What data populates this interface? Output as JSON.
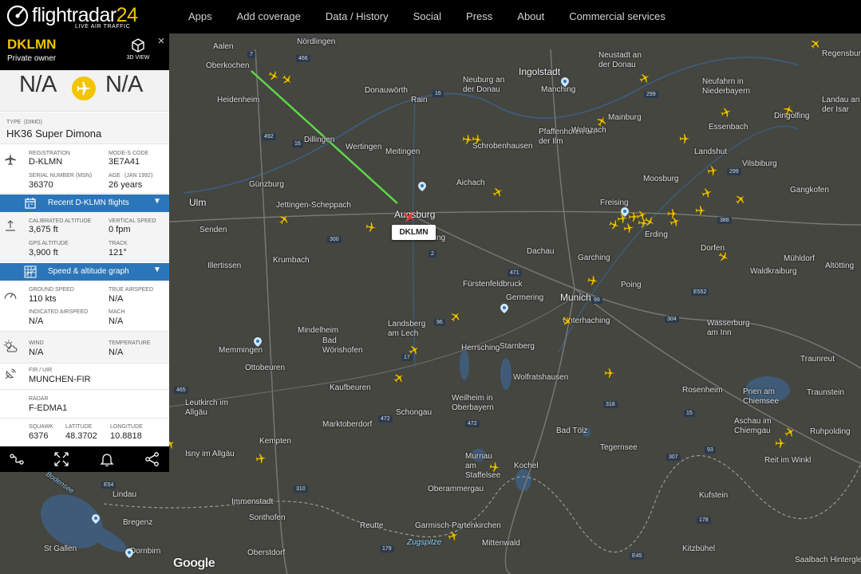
{
  "brand": {
    "name": "flightradar",
    "number": "24",
    "tagline": "LIVE AIR TRAFFIC"
  },
  "nav": [
    "Apps",
    "Add coverage",
    "Data / History",
    "Social",
    "Press",
    "About",
    "Commercial services"
  ],
  "panel": {
    "callsign": "DKLMN",
    "owner": "Private owner",
    "view3d": "3D VIEW",
    "close": "×",
    "origin": "N/A",
    "destination": "N/A",
    "type_label": "TYPE",
    "type_code": "(DIMO)",
    "type_name": "HK36 Super Dimona",
    "registration_label": "REGISTRATION",
    "registration": "D-KLMN",
    "modes_label": "MODE-S CODE",
    "modes": "3E7A41",
    "serial_label": "SERIAL NUMBER (MSN)",
    "serial": "36370",
    "age_label": "AGE",
    "age_date": "(JAN 1992)",
    "age": "26 years",
    "recent_flights": "Recent D-KLMN flights",
    "cal_alt_label": "CALIBRATED ALTITUDE",
    "cal_alt": "3,675 ft",
    "vspeed_label": "VERTICAL SPEED",
    "vspeed": "0 fpm",
    "gps_alt_label": "GPS ALTITUDE",
    "gps_alt": "3,900 ft",
    "track_label": "TRACK",
    "track": "121°",
    "speed_graph": "Speed & altitude graph",
    "gspeed_label": "GROUND SPEED",
    "gspeed": "110 kts",
    "tas_label": "TRUE AIRSPEED",
    "tas": "N/A",
    "ias_label": "INDICATED AIRSPEED",
    "ias": "N/A",
    "mach_label": "MACH",
    "mach": "N/A",
    "wind_label": "WIND",
    "wind": "N/A",
    "temp_label": "TEMPERATURE",
    "temp": "N/A",
    "fir_label": "FIR / UIR",
    "fir": "MUNCHEN-FIR",
    "radar_label": "RADAR",
    "radar": "F-EDMA1",
    "squawk_label": "SQUAWK",
    "squawk": "6376",
    "lat_label": "LATITUDE",
    "lat": "48.3702",
    "lon_label": "LONGITUDE",
    "lon": "10.8818"
  },
  "map": {
    "flight_tag": "DKLMN",
    "attribution": "Google",
    "towns": [
      "Aalen",
      "Nördlingen",
      "Oberkochen",
      "Heidenheim",
      "Donauwörth",
      "Rain",
      "Neuburg an der Donau",
      "Ingolstadt",
      "Manching",
      "Neustadt an der Donau",
      "Regensburg",
      "Neufahrn in Niederbayern",
      "Landau an der Isar",
      "Dillingen",
      "Wertingen",
      "Meitingen",
      "Schrobenhausen",
      "Pfaffenhofen an der Ilm",
      "Wolnzach",
      "Mainburg",
      "Essenbach",
      "Dingolfing",
      "Landshut",
      "Vilsbiburg",
      "Gangkofen",
      "Günzburg",
      "Jettingen-Scheppach",
      "Augsburg",
      "Aichach",
      "Moosburg",
      "Freising",
      "Erding",
      "Ulm",
      "Senden",
      "Kissing",
      "Dachau",
      "Garching",
      "Dorfen",
      "Mühldorf",
      "Altötting",
      "Waldkraiburg",
      "Illertissen",
      "Krumbach",
      "Fürstenfeldbruck",
      "Germering",
      "Munich",
      "Poing",
      "Unterhaching",
      "Memmingen",
      "Mindelheim",
      "Bad Wörishofen",
      "Landsberg am Lech",
      "Herrsching",
      "Starnberg",
      "Wasserburg am Inn",
      "Traunreut",
      "Ottobeuren",
      "Kaufbeuren",
      "Wolfratshausen",
      "Leutkirch im Allgäu",
      "Marktoberdorf",
      "Schongau",
      "Weilheim in Oberbayern",
      "Bad Tölz",
      "Rosenheim",
      "Prien am Chiemsee",
      "Traunstein",
      "Tegernsee",
      "Aschau im Chiemgau",
      "Ruhpolding",
      "Kempten",
      "Isny im Allgäu",
      "Murnau am Staffelsee",
      "Kochel",
      "Reit im Winkl",
      "Immenstadt",
      "Oberammergau",
      "Kufstein",
      "Lindau",
      "Sonthofen",
      "Bregenz",
      "Reutte",
      "Garmisch-Partenkirchen",
      "Mittenwald",
      "Kitzbühel",
      "St Gallen",
      "Dornbirn",
      "Oberstdorf",
      "Zugspitze",
      "Saalbach Hinterglemm",
      "Bodensee"
    ]
  },
  "icons": {
    "close": "close-icon",
    "view3d": "cube-icon",
    "route": "airplane-icon",
    "footer": [
      "route-icon",
      "expand-icon",
      "bell-icon",
      "share-icon"
    ]
  },
  "colors": {
    "accent": "#f2c500",
    "bar": "#2b76b9",
    "track": "#5fd64a",
    "map": "#44463f"
  }
}
